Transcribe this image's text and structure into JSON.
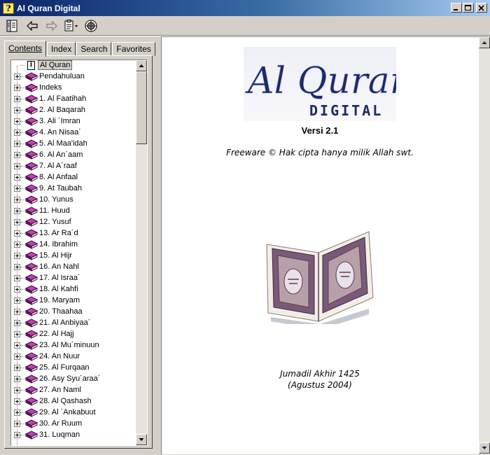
{
  "window": {
    "title": "Al Quran Digital",
    "icon": "help-question-icon"
  },
  "toolbar": {
    "icons": [
      "hide-tree-icon",
      "back-arrow-icon",
      "forward-arrow-icon",
      "options-icon",
      "web-help-icon"
    ]
  },
  "tabs": [
    {
      "label": "Contents",
      "active": true
    },
    {
      "label": "Index",
      "active": false
    },
    {
      "label": "Search",
      "active": false
    },
    {
      "label": "Favorites",
      "active": false
    }
  ],
  "tree": {
    "items": [
      {
        "label": "Al Quran",
        "icon": "document-icon"
      },
      {
        "label": "Pendahuluan",
        "icon": "book-icon"
      },
      {
        "label": "Indeks",
        "icon": "book-icon"
      },
      {
        "label": "1. Al Faatihah",
        "icon": "book-icon"
      },
      {
        "label": "2. Al Baqarah",
        "icon": "book-icon"
      },
      {
        "label": "3. Ali ´Imran",
        "icon": "book-icon"
      },
      {
        "label": "4. An Nisaa´",
        "icon": "book-icon"
      },
      {
        "label": "5. Al Maa'idah",
        "icon": "book-icon"
      },
      {
        "label": "6. Al An´aam",
        "icon": "book-icon"
      },
      {
        "label": "7. Al A´raaf",
        "icon": "book-icon"
      },
      {
        "label": "8. Al Anfaal",
        "icon": "book-icon"
      },
      {
        "label": "9. At Taubah",
        "icon": "book-icon"
      },
      {
        "label": "10. Yunus",
        "icon": "book-icon"
      },
      {
        "label": "11. Huud",
        "icon": "book-icon"
      },
      {
        "label": "12. Yusuf",
        "icon": "book-icon"
      },
      {
        "label": "13. Ar Ra´d",
        "icon": "book-icon"
      },
      {
        "label": "14. Ibrahim",
        "icon": "book-icon"
      },
      {
        "label": "15. Al Hijr",
        "icon": "book-icon"
      },
      {
        "label": "16. An Nahl",
        "icon": "book-icon"
      },
      {
        "label": "17. Al Israa´",
        "icon": "book-icon"
      },
      {
        "label": "18. Al Kahfi",
        "icon": "book-icon"
      },
      {
        "label": "19. Maryam",
        "icon": "book-icon"
      },
      {
        "label": "20. Thaahaa",
        "icon": "book-icon"
      },
      {
        "label": "21. Al Anbiyaa´",
        "icon": "book-icon"
      },
      {
        "label": "22. Al Hajj",
        "icon": "book-icon"
      },
      {
        "label": "23. Al Mu´minuun",
        "icon": "book-icon"
      },
      {
        "label": "24. An Nuur",
        "icon": "book-icon"
      },
      {
        "label": "25. Al Furqaan",
        "icon": "book-icon"
      },
      {
        "label": "26. Asy Syu´araa´",
        "icon": "book-icon"
      },
      {
        "label": "27. An Naml",
        "icon": "book-icon"
      },
      {
        "label": "28. Al Qashash",
        "icon": "book-icon"
      },
      {
        "label": "29. Al ´Ankabuut",
        "icon": "book-icon"
      },
      {
        "label": "30. Ar Ruum",
        "icon": "book-icon"
      },
      {
        "label": "31. Luqman",
        "icon": "book-icon"
      }
    ]
  },
  "content": {
    "logo_line1": "Al Quran",
    "logo_line2": "DIGITAL",
    "version": "Versi 2.1",
    "freeware": "Freeware © Hak cipta hanya milik Allah swt.",
    "date_line1": "Jumadil Akhir 1425",
    "date_line2": "(Agustus 2004)"
  },
  "colors": {
    "titlebar": "#0a246a",
    "book": "#a0208a",
    "logo_text": "#1a2a6c"
  }
}
